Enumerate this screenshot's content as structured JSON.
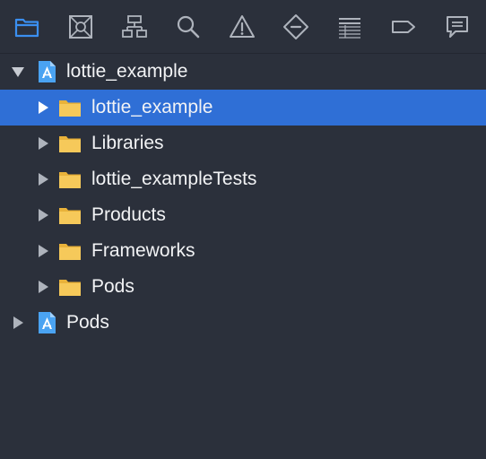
{
  "toolbar": {
    "icons": [
      {
        "name": "project-navigator",
        "icon": "folder-icon",
        "active": true
      },
      {
        "name": "source-control-navigator",
        "icon": "source-control-icon",
        "active": false
      },
      {
        "name": "symbol-navigator",
        "icon": "hierarchy-icon",
        "active": false
      },
      {
        "name": "find-navigator",
        "icon": "search-icon",
        "active": false
      },
      {
        "name": "issue-navigator",
        "icon": "warning-icon",
        "active": false
      },
      {
        "name": "test-navigator",
        "icon": "test-diamond-icon",
        "active": false
      },
      {
        "name": "debug-navigator",
        "icon": "debug-list-icon",
        "active": false
      },
      {
        "name": "breakpoint-navigator",
        "icon": "breakpoint-icon",
        "active": false
      },
      {
        "name": "report-navigator",
        "icon": "message-icon",
        "active": false
      }
    ],
    "colors": {
      "active": "#3b8ff0",
      "inactive": "#aeb3bc"
    }
  },
  "tree": {
    "items": [
      {
        "label": "lottie_example",
        "kind": "project",
        "expanded": true,
        "selected": false,
        "level": 0
      },
      {
        "label": "lottie_example",
        "kind": "folder",
        "expanded": false,
        "selected": true,
        "level": 1
      },
      {
        "label": "Libraries",
        "kind": "folder",
        "expanded": false,
        "selected": false,
        "level": 1
      },
      {
        "label": "lottie_exampleTests",
        "kind": "folder",
        "expanded": false,
        "selected": false,
        "level": 1
      },
      {
        "label": "Products",
        "kind": "folder",
        "expanded": false,
        "selected": false,
        "level": 1
      },
      {
        "label": "Frameworks",
        "kind": "folder",
        "expanded": false,
        "selected": false,
        "level": 1
      },
      {
        "label": "Pods",
        "kind": "folder",
        "expanded": false,
        "selected": false,
        "level": 1
      },
      {
        "label": "Pods",
        "kind": "project",
        "expanded": false,
        "selected": false,
        "level": 0
      }
    ]
  },
  "colors": {
    "background": "#2b303b",
    "selection": "#2f6fd6",
    "folder": "#f3c24e",
    "project": "#4aa3f2"
  }
}
